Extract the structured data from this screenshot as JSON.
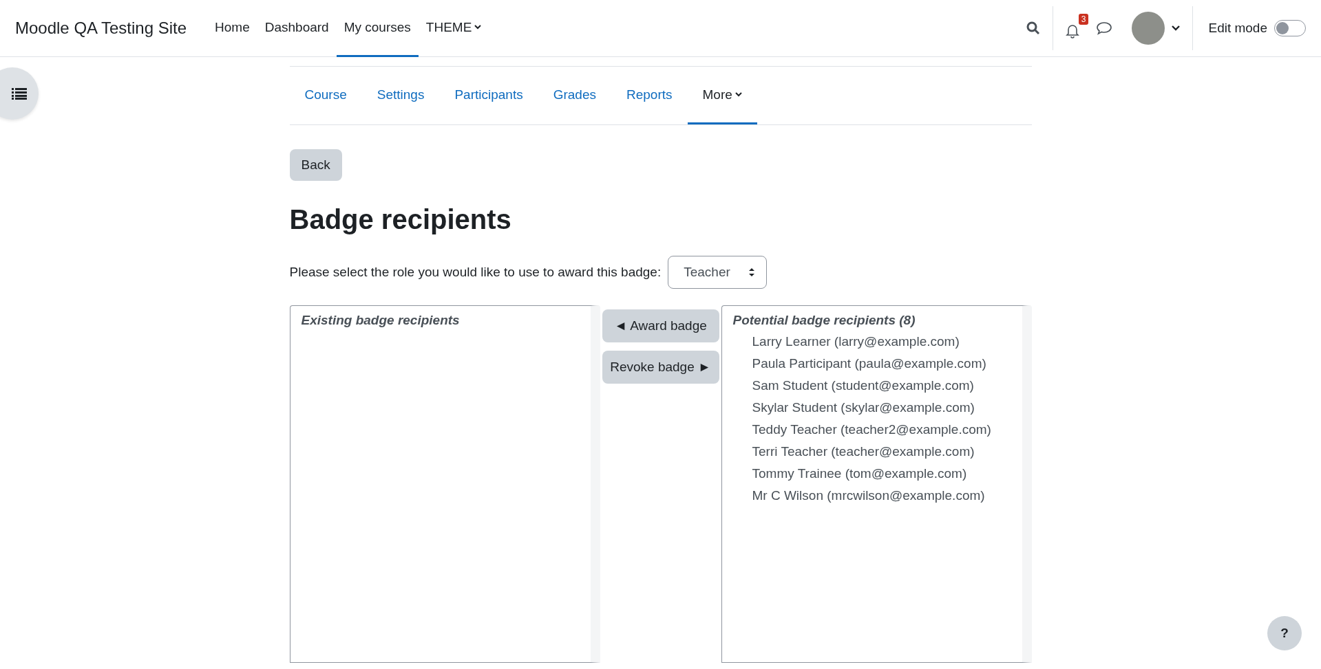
{
  "navbar": {
    "site_name": "Moodle QA Testing Site",
    "items": [
      {
        "label": "Home",
        "selected": false,
        "dropdown": false
      },
      {
        "label": "Dashboard",
        "selected": false,
        "dropdown": false
      },
      {
        "label": "My courses",
        "selected": true,
        "dropdown": false
      },
      {
        "label": "THEME",
        "selected": false,
        "dropdown": true
      }
    ],
    "notification_count": "3",
    "edit_mode": {
      "label": "Edit mode",
      "on": false
    }
  },
  "secondary_nav": [
    {
      "label": "Course",
      "selected": false,
      "dropdown": false
    },
    {
      "label": "Settings",
      "selected": false,
      "dropdown": false
    },
    {
      "label": "Participants",
      "selected": false,
      "dropdown": false
    },
    {
      "label": "Grades",
      "selected": false,
      "dropdown": false
    },
    {
      "label": "Reports",
      "selected": false,
      "dropdown": false
    },
    {
      "label": "More",
      "selected": true,
      "dropdown": true
    }
  ],
  "back_button": "Back",
  "heading": "Badge recipients",
  "role_prompt": "Please select the role you would like to use to award this badge:",
  "role_select": "Teacher",
  "existing": {
    "group_label": "Existing badge recipients"
  },
  "actions": [
    "◄ Award badge",
    "Revoke badge ►"
  ],
  "potential": {
    "group_label": "Potential badge recipients (8)",
    "items": [
      {
        "label": "Larry Learner (larry@example.com)",
        "selected": false
      },
      {
        "label": "Paula Participant (paula@example.com)",
        "selected": false
      },
      {
        "label": "Sam Student (student@example.com)",
        "selected": false
      },
      {
        "label": "Skylar Student (skylar@example.com)",
        "selected": false
      },
      {
        "label": "Teddy Teacher (teacher2@example.com)",
        "selected": false
      },
      {
        "label": "Terri Teacher (teacher@example.com)",
        "selected": false
      },
      {
        "label": "Tommy Trainee (tom@example.com)",
        "selected": false
      },
      {
        "label": "Mr C Wilson (mrcwilson@example.com)",
        "selected": false
      }
    ]
  },
  "help_button": "?"
}
